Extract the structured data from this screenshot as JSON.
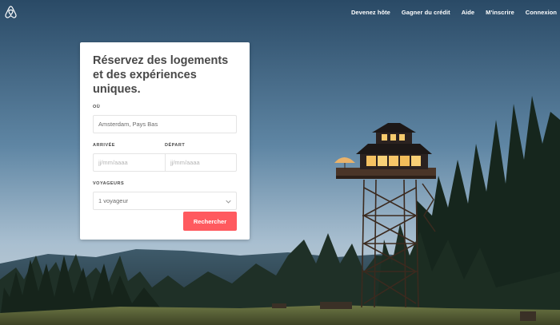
{
  "nav": {
    "links": [
      "Devenez hôte",
      "Gagner du crédit",
      "Aide",
      "M'inscrire",
      "Connexion"
    ]
  },
  "search_card": {
    "headline": "Réservez des logements et des expériences uniques.",
    "where": {
      "label": "OÙ",
      "value": "Amsterdam, Pays Bas"
    },
    "checkin": {
      "label": "ARRIVÉE",
      "placeholder": "jj/mm/aaaa"
    },
    "checkout": {
      "label": "DÉPART",
      "placeholder": "jj/mm/aaaa"
    },
    "guests": {
      "label": "VOYAGEURS",
      "value": "1 voyageur"
    },
    "submit_label": "Rechercher"
  },
  "colors": {
    "brand": "#ff5a5f",
    "nav_text": "#ffffff"
  }
}
